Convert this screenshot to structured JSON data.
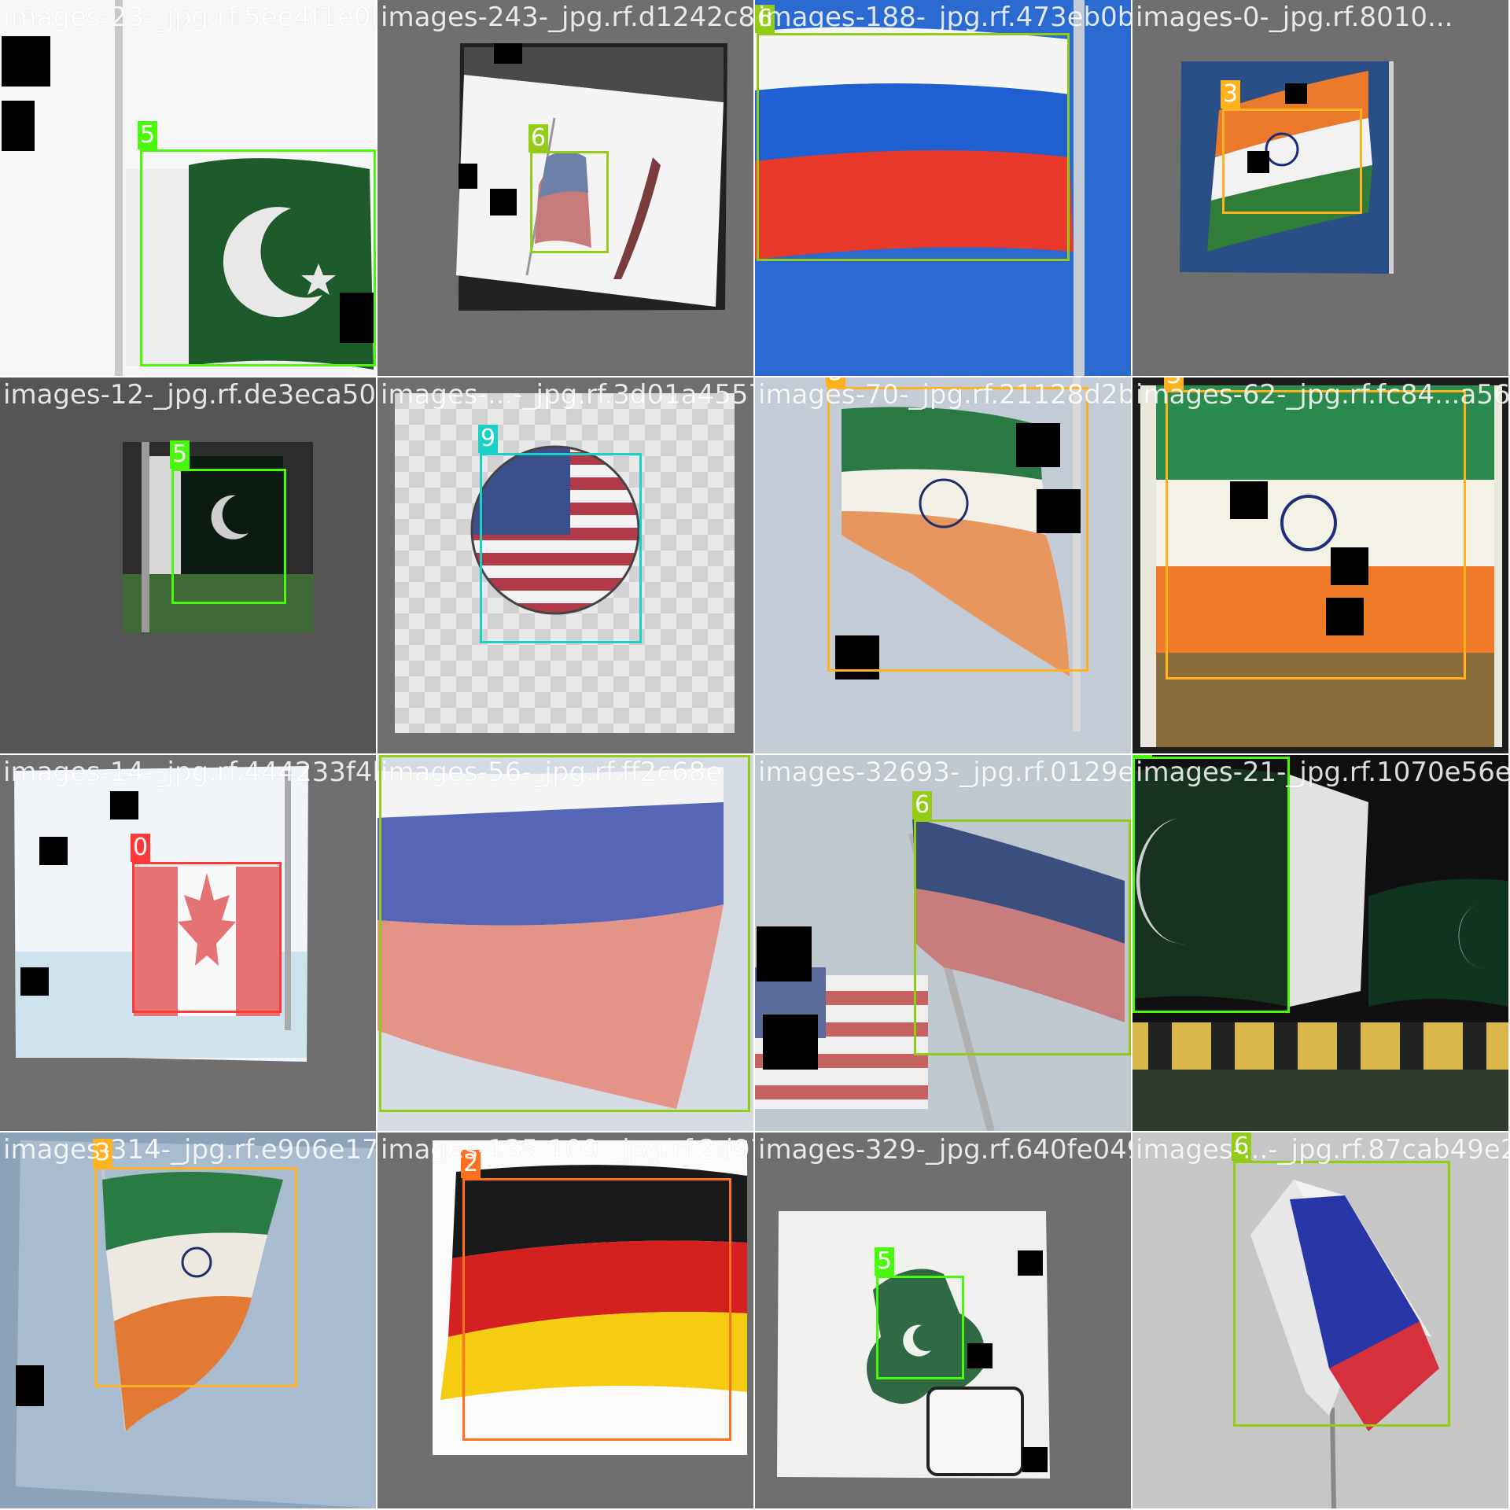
{
  "classes": {
    "0": {
      "color": "#ff3838"
    },
    "2": {
      "color": "#ff701f"
    },
    "3": {
      "color": "#ffb21d"
    },
    "5": {
      "color": "#48f90a"
    },
    "6": {
      "color": "#92cc17"
    },
    "9": {
      "color": "#1ad0c7"
    }
  },
  "tiles": [
    {
      "filename": "images-23-_jpg.rf.5ee4f1e0b7750d84243afb3",
      "scene": "pakistan-flag-pole",
      "bg": "#ffffff",
      "boxes": [
        {
          "cls": "5"
        }
      ]
    },
    {
      "filename": "images-243-_jpg.rf.d1242c806234180188ada5f",
      "scene": "small-russia-flag-photo",
      "bg": "#6f6f6f",
      "boxes": [
        {
          "cls": "6"
        }
      ]
    },
    {
      "filename": "images-188-_jpg.rf.473eb0b880105b0b62220e4f63151597",
      "scene": "russia-flag-sky",
      "bg": "#1f63c4",
      "boxes": [
        {
          "cls": "6"
        }
      ]
    },
    {
      "filename": "images-0-_jpg.rf.8010...",
      "scene": "india-flag-sky",
      "bg": "#6f6f6f",
      "boxes": [
        {
          "cls": "3"
        }
      ]
    },
    {
      "filename": "images-12-_jpg.rf.de3eca50a",
      "scene": "pakistan-flag-dark",
      "bg": "#505050",
      "boxes": [
        {
          "cls": "5"
        }
      ]
    },
    {
      "filename": "images-...-_jpg.rf.3d01a4557052",
      "scene": "usa-flag-sphere",
      "bg": "#dcdcdc",
      "boxes": [
        {
          "cls": "9"
        }
      ]
    },
    {
      "filename": "images-70-_jpg.rf.21128d2b3c",
      "scene": "india-flag-pole",
      "bg": "#bcc6d0",
      "boxes": [
        {
          "cls": "3"
        }
      ]
    },
    {
      "filename": "images-62-_jpg.rf.fc84...a56",
      "scene": "india-flag-held",
      "bg": "#2a2a2a",
      "boxes": [
        {
          "cls": "3"
        }
      ]
    },
    {
      "filename": "images-14-_jpg.rf.444233f4b",
      "scene": "canada-flag",
      "bg": "#6f6f6f",
      "boxes": [
        {
          "cls": "0"
        }
      ]
    },
    {
      "filename": "images-56-_jpg.rf.ff2c68e",
      "scene": "russia-flag-closeup",
      "bg": "#c8cfd6",
      "boxes": [
        {
          "cls": "6"
        }
      ]
    },
    {
      "filename": "images-32693-_jpg.rf.0129e7a87db7b",
      "scene": "russia-usa-flags",
      "bg": "#b6bec6",
      "boxes": [
        {
          "cls": "6"
        }
      ]
    },
    {
      "filename": "images-21-_jpg.rf.1070e56e81a08",
      "scene": "pakistan-flag-night",
      "bg": "#0d0d0d",
      "boxes": [
        {
          "cls": "5"
        }
      ]
    },
    {
      "filename": "images-314-_jpg.rf.e906e170",
      "scene": "india-flag-frayed",
      "bg": "#9fb0c2",
      "boxes": [
        {
          "cls": "3"
        }
      ]
    },
    {
      "filename": "images-135-109-_jpg.rf.2d97a603",
      "scene": "germany-flag",
      "bg": "#6f6f6f",
      "boxes": [
        {
          "cls": "2"
        }
      ]
    },
    {
      "filename": "images-329-_jpg.rf.640fe049a",
      "scene": "pakistan-map-card",
      "bg": "#6f6f6f",
      "boxes": [
        {
          "cls": "5"
        }
      ]
    },
    {
      "filename": "images-...-_jpg.rf.87cab49e2",
      "scene": "russia-flag-small",
      "bg": "#c4c4c4",
      "boxes": [
        {
          "cls": "6"
        }
      ]
    }
  ]
}
